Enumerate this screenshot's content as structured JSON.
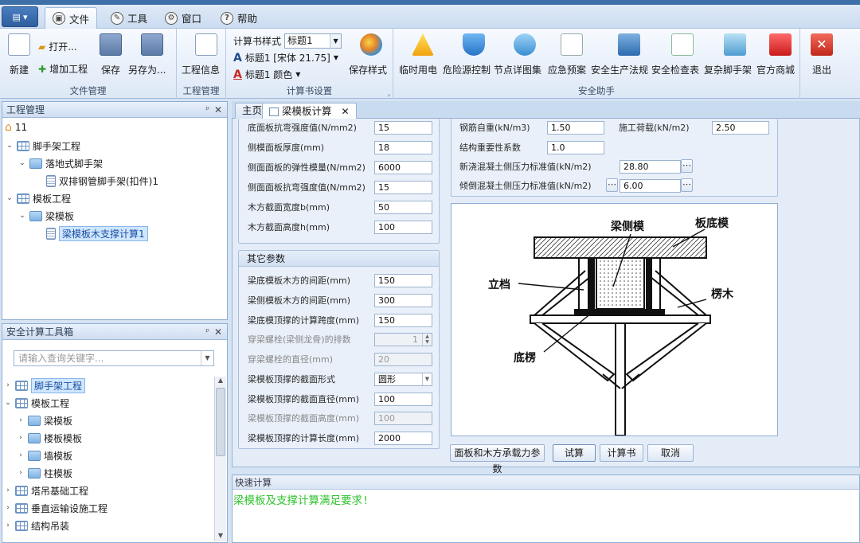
{
  "menubar": {
    "tabs": [
      {
        "label": "文件",
        "icon": "file-icon"
      },
      {
        "label": "工具",
        "icon": "wrench-icon"
      },
      {
        "label": "窗口",
        "icon": "gear-icon"
      },
      {
        "label": "帮助",
        "icon": "help-icon"
      }
    ]
  },
  "ribbon": {
    "file_group": {
      "label": "文件管理",
      "new": "新建",
      "open": "打开...",
      "add_project": "增加工程",
      "save": "保存",
      "save_as": "另存为..."
    },
    "project_group": {
      "label": "工程管理",
      "info": "工程信息"
    },
    "book_group": {
      "label": "计算书设置",
      "style_label": "计算书样式",
      "style_value": "标题1",
      "font_value": "标题1 [宋体 21.75]",
      "color_value": "标题1 颜色",
      "save_style": "保存样式"
    },
    "safety_group": {
      "label": "安全助手",
      "items": [
        "临时用电",
        "危险源控制",
        "节点详图集",
        "应急预案",
        "安全生产法规",
        "安全检查表",
        "复杂脚手架",
        "官方商城"
      ]
    },
    "exit": "退出"
  },
  "project_panel": {
    "title": "工程管理",
    "items": [
      "11",
      "脚手架工程",
      "落地式脚手架",
      "双排钢管脚手架(扣件)1",
      "模板工程",
      "梁模板",
      "梁模板木支撑计算1"
    ]
  },
  "toolbox_panel": {
    "title": "安全计算工具箱",
    "search_placeholder": "请输入查询关键字...",
    "items": [
      "脚手架工程",
      "模板工程",
      "梁模板",
      "楼板模板",
      "墙模板",
      "柱模板",
      "塔吊基础工程",
      "垂直运输设施工程",
      "结构吊装"
    ]
  },
  "doc_tabs": {
    "home": "主页",
    "active": "梁模板计算"
  },
  "form_left": [
    {
      "label": "底面板抗弯强度值(N/mm2)",
      "value": "15"
    },
    {
      "label": "侧模面板厚度(mm)",
      "value": "18"
    },
    {
      "label": "侧面面板的弹性模量(N/mm2)",
      "value": "6000"
    },
    {
      "label": "侧面面板抗弯强度值(N/mm2)",
      "value": "15"
    },
    {
      "label": "木方截面宽度b(mm)",
      "value": "50"
    },
    {
      "label": "木方截面高度h(mm)",
      "value": "100"
    }
  ],
  "other_params": {
    "title": "其它参数",
    "rows": [
      {
        "label": "梁底模板木方的间距(mm)",
        "value": "150"
      },
      {
        "label": "梁侧模板木方的间距(mm)",
        "value": "300"
      },
      {
        "label": "梁底模顶撑的计算跨度(mm)",
        "value": "150"
      },
      {
        "label": "穿梁螺栓(梁侧龙骨)的排数",
        "value": "1"
      },
      {
        "label": "穿梁螺栓的直径(mm)",
        "value": "20"
      },
      {
        "label": "梁模板顶撑的截面形式",
        "value": "圆形"
      },
      {
        "label": "梁模板顶撑的截面直径(mm)",
        "value": "100"
      },
      {
        "label": "梁模板顶撑的截面高度(mm)",
        "value": "100"
      },
      {
        "label": "梁模板顶撑的计算长度(mm)",
        "value": "2000"
      }
    ]
  },
  "form_right": {
    "rebar_label": "钢筋自重(kN/m3)",
    "rebar_value": "1.50",
    "load_label": "施工荷载(kN/m2)",
    "load_value": "2.50",
    "importance_label": "结构重要性系数",
    "importance_value": "1.0",
    "pressure_label": "新浇混凝土侧压力标准值(kN/m2)",
    "pressure_value": "28.80",
    "pour_label": "倾倒混凝土侧压力标准值(kN/m2)",
    "pour_value": "6.00"
  },
  "diagram": {
    "label_side": "梁侧模",
    "label_bottom_plate": "板底模",
    "label_post": "立档",
    "label_brace": "楞木",
    "label_base": "底楞"
  },
  "buttons": {
    "params": "面板和木方承载力参数",
    "trial": "试算",
    "book": "计算书",
    "cancel": "取消"
  },
  "quick": {
    "title": "快速计算",
    "result": "梁模板及支撑计算满足要求!"
  },
  "colors": {
    "ribbon_bg": "#dde8f6",
    "selected": "#cfe6ff",
    "result_text": "#2fc22f"
  }
}
